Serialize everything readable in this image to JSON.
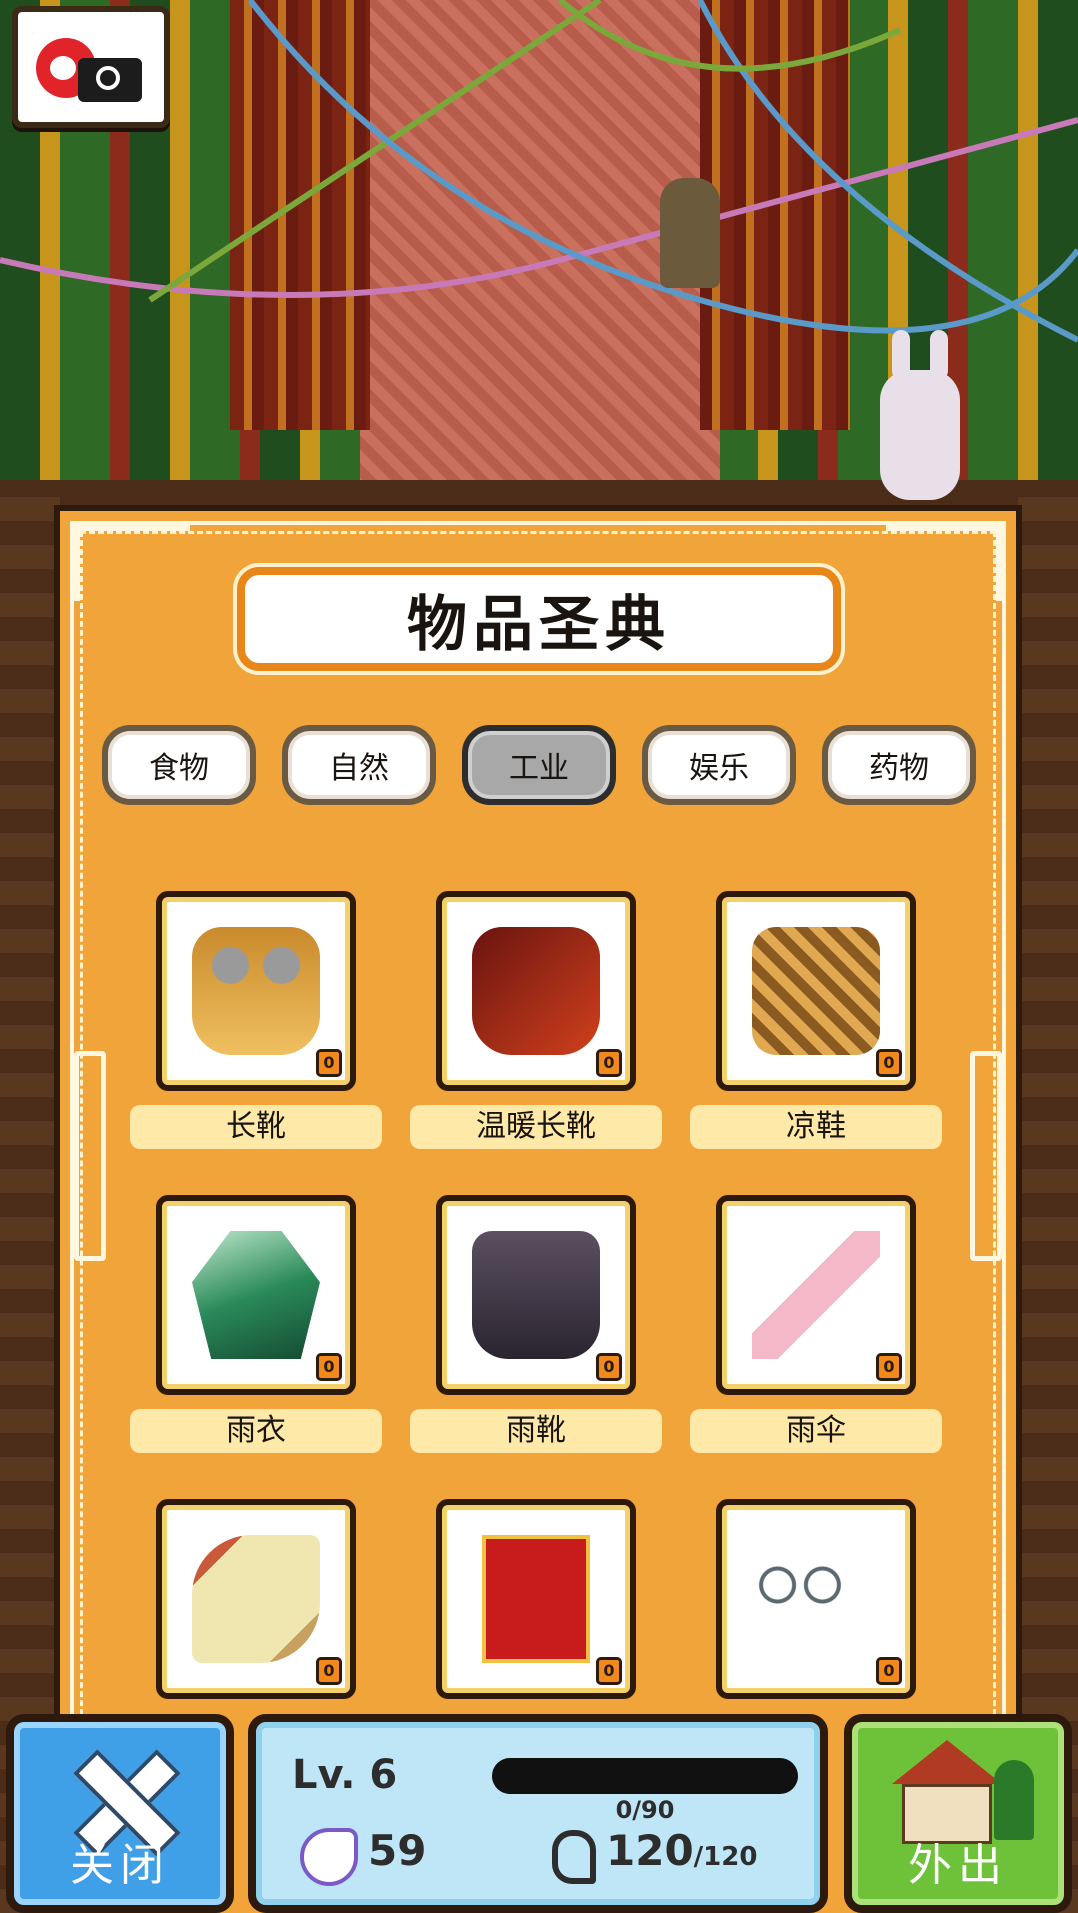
{
  "screen": {
    "title": "物品圣典"
  },
  "tabs": [
    {
      "label": "食物",
      "active": false
    },
    {
      "label": "自然",
      "active": false
    },
    {
      "label": "工业",
      "active": true
    },
    {
      "label": "娱乐",
      "active": false
    },
    {
      "label": "药物",
      "active": false
    }
  ],
  "items": [
    {
      "name": "长靴",
      "count": "0",
      "icon": "boots-icon"
    },
    {
      "name": "温暖长靴",
      "count": "0",
      "icon": "warm-boots-icon"
    },
    {
      "name": "凉鞋",
      "count": "0",
      "icon": "sandals-icon"
    },
    {
      "name": "雨衣",
      "count": "0",
      "icon": "raincoat-icon"
    },
    {
      "name": "雨靴",
      "count": "0",
      "icon": "rain-boots-icon"
    },
    {
      "name": "雨伞",
      "count": "0",
      "icon": "umbrella-icon"
    },
    {
      "name": "",
      "count": "0",
      "icon": "horn-icon"
    },
    {
      "name": "",
      "count": "0",
      "icon": "red-book-icon"
    },
    {
      "name": "",
      "count": "0",
      "icon": "glasses-icon"
    }
  ],
  "bottom": {
    "close_label": "关闭",
    "out_label": "外出",
    "level": "Lv. 6",
    "exp_text": "0/90",
    "exp_fraction": 0,
    "hand_value": "59",
    "stamina_value": "120",
    "stamina_max": "/120"
  },
  "colors": {
    "panel": "#f0a43a",
    "close_button": "#3fa0e8",
    "out_button": "#6ec23a",
    "status_panel": "#bfe6f6",
    "active_tab": "#a8a8a8"
  }
}
